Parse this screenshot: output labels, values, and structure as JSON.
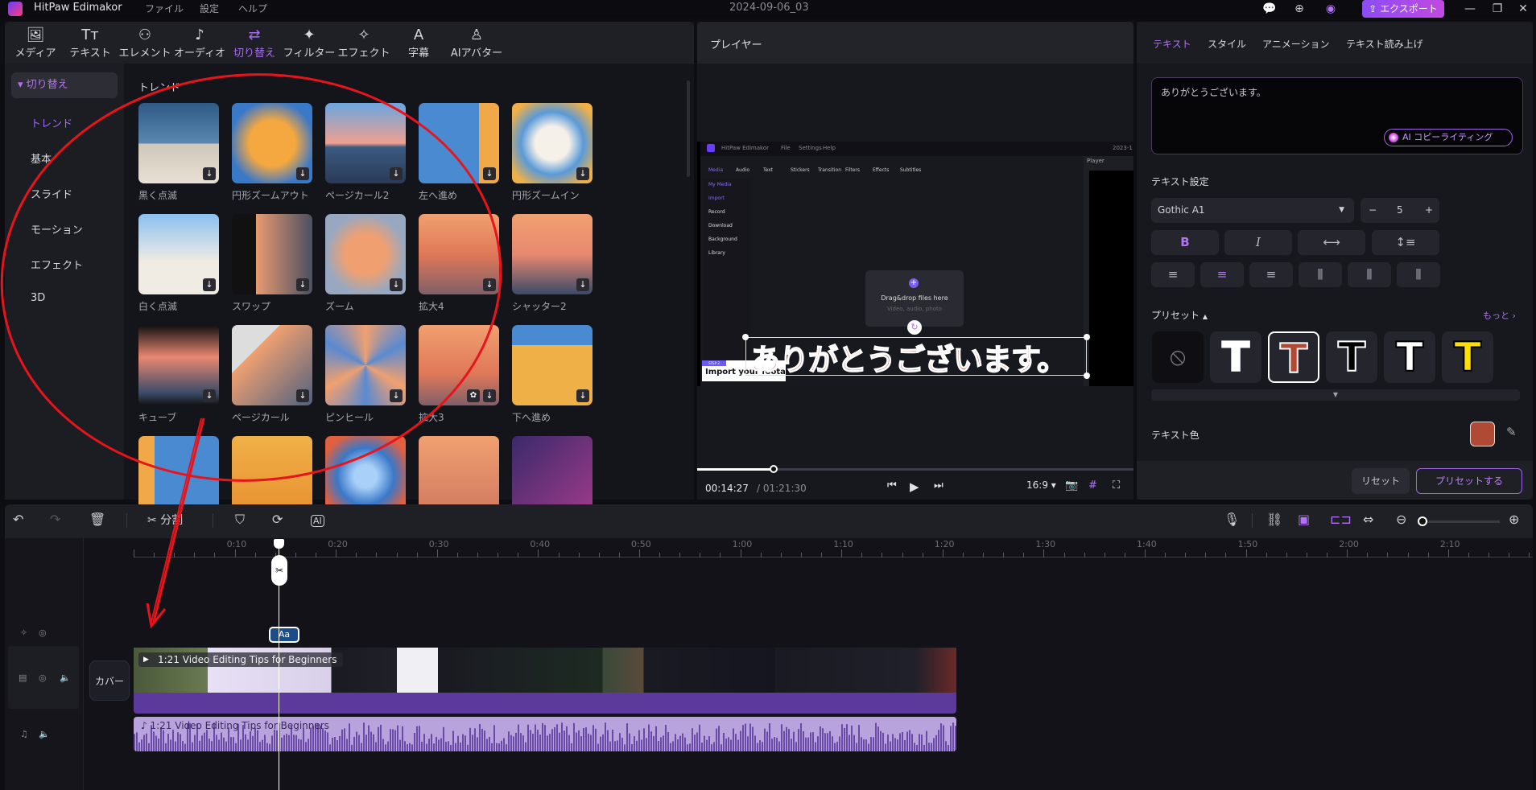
{
  "titlebar": {
    "app_name": "HitPaw Edimakor",
    "menus": [
      "ファイル",
      "設定",
      "ヘルプ"
    ],
    "document_title": "2024-09-06_03",
    "export_label": "エクスポート"
  },
  "toolbar": {
    "tools": [
      {
        "label": "メディア",
        "icon": "media-icon"
      },
      {
        "label": "テキスト",
        "icon": "text-icon"
      },
      {
        "label": "エレメント",
        "icon": "element-icon"
      },
      {
        "label": "オーディオ",
        "icon": "audio-icon"
      },
      {
        "label": "切り替え",
        "icon": "transition-icon",
        "active": true
      },
      {
        "label": "フィルター",
        "icon": "filter-icon"
      },
      {
        "label": "エフェクト",
        "icon": "effect-icon"
      },
      {
        "label": "字幕",
        "icon": "subtitle-icon"
      },
      {
        "label": "AIアバター",
        "icon": "ai-avatar-icon"
      }
    ]
  },
  "sidebar": {
    "category": "切り替え",
    "items": [
      {
        "label": "トレンド",
        "active": true
      },
      {
        "label": "基本"
      },
      {
        "label": "スライド"
      },
      {
        "label": "モーション"
      },
      {
        "label": "エフェクト"
      },
      {
        "label": "3D"
      }
    ]
  },
  "grid": {
    "section_title": "トレンド",
    "items": [
      {
        "label": "黒く点滅"
      },
      {
        "label": "円形ズームアウト"
      },
      {
        "label": "ページカール2"
      },
      {
        "label": "左へ進め"
      },
      {
        "label": "円形ズームイン"
      },
      {
        "label": "白く点滅"
      },
      {
        "label": "スワップ"
      },
      {
        "label": "ズーム"
      },
      {
        "label": "拡大4"
      },
      {
        "label": "シャッター2"
      },
      {
        "label": "キューブ"
      },
      {
        "label": "ページカール"
      },
      {
        "label": "ピンヒール"
      },
      {
        "label": "拡大3",
        "favorite": true
      },
      {
        "label": "下へ進め"
      },
      {
        "label": ""
      },
      {
        "label": ""
      },
      {
        "label": ""
      },
      {
        "label": ""
      },
      {
        "label": ""
      }
    ]
  },
  "player": {
    "title": "プレイヤー",
    "overlay_text": "ありがとうございます。",
    "inner_app": {
      "name": "HitPaw Edimakor",
      "menus": [
        "File",
        "Settings",
        "Help"
      ],
      "date": "2023-1",
      "tools": [
        "Media",
        "Audio",
        "Text",
        "Stickers",
        "Transition",
        "Filters",
        "Effects",
        "Subtitles"
      ],
      "side": [
        "My Media",
        "Import",
        "Record",
        "Download",
        "Background",
        "Library"
      ],
      "drop_title": "Drag&drop files here",
      "drop_sub": "Video, audio, photo",
      "player_label": "Player",
      "step_badge": "STEP 2",
      "step_text": "Import your footage"
    },
    "current_time": "00:14:27",
    "total_time": "/ 01:21:30",
    "progress": 0.177,
    "aspect": "16:9"
  },
  "properties": {
    "tabs": [
      {
        "label": "テキスト",
        "active": true
      },
      {
        "label": "スタイル"
      },
      {
        "label": "アニメーション"
      },
      {
        "label": "テキスト読み上げ"
      }
    ],
    "text_value": "ありがとうございます。",
    "ai_copy_label": "AI コピーライティング",
    "text_settings_label": "テキスト設定",
    "font": "Gothic A1",
    "font_size": "5",
    "preset_label": "プリセット",
    "more_label": "もっと",
    "presets": [
      {
        "name": "none",
        "color": "",
        "stroke": ""
      },
      {
        "name": "white",
        "color": "#ffffff",
        "stroke": "#ffffff"
      },
      {
        "name": "red-brown",
        "color": "#b04a35",
        "stroke": "#ffffff",
        "selected": true
      },
      {
        "name": "black-outline",
        "color": "#000000",
        "stroke": "#ffffff"
      },
      {
        "name": "white-black-outline",
        "color": "#ffffff",
        "stroke": "#000000"
      },
      {
        "name": "yellow",
        "color": "#ffe000",
        "stroke": "#000000"
      }
    ],
    "text_color_label": "テキスト色",
    "text_color": "#b04a35",
    "reset_label": "リセット",
    "apply_label": "プリセットする"
  },
  "timeline": {
    "split_label": "分割",
    "ruler": [
      "0:10",
      "0:20",
      "0:30",
      "0:40",
      "0:50",
      "1:00",
      "1:10",
      "1:20",
      "1:30",
      "1:40",
      "1:50",
      "2:00",
      "2:10"
    ],
    "cover_label": "カバー",
    "text_clip_label": "Aa",
    "video_clip_title": "1:21 Video Editing Tips for Beginners",
    "audio_clip_title": "1:21 Video Editing Tips for Beginners",
    "zoom_level": 0.0
  },
  "colors": {
    "accent": "#a66cf2",
    "annotation": "#e8141c"
  }
}
